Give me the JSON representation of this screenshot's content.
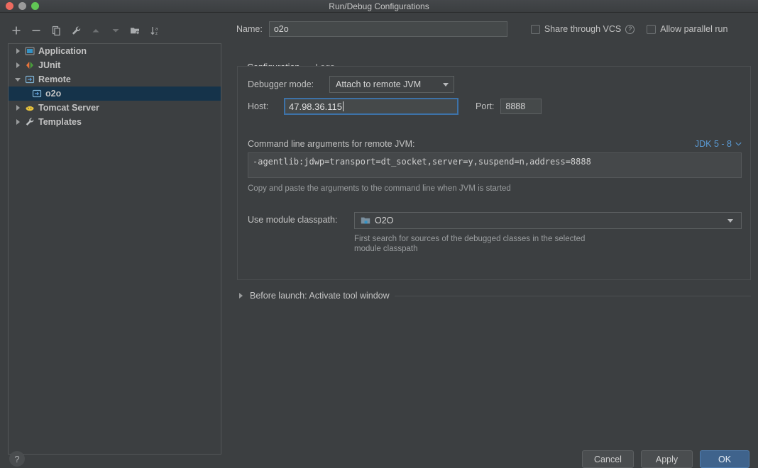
{
  "window": {
    "title": "Run/Debug Configurations",
    "controls": [
      "close",
      "minimize",
      "maximize"
    ]
  },
  "tree_toolbar": {
    "buttons": [
      {
        "name": "add-button",
        "icon": "plus-icon"
      },
      {
        "name": "remove-button",
        "icon": "minus-icon"
      },
      {
        "name": "copy-button",
        "icon": "copy-icon"
      },
      {
        "name": "edit-templates-button",
        "icon": "wrench-icon"
      },
      {
        "name": "move-up-button",
        "icon": "arrow-up-icon"
      },
      {
        "name": "move-down-button",
        "icon": "arrow-down-icon"
      },
      {
        "name": "new-folder-button",
        "icon": "folder-add-icon"
      },
      {
        "name": "sort-button",
        "icon": "sort-alpha-icon"
      }
    ]
  },
  "tree": {
    "items": [
      {
        "label": "Application",
        "icon": "application-icon",
        "expanded": false,
        "selected": false,
        "child": false
      },
      {
        "label": "JUnit",
        "icon": "junit-icon",
        "expanded": false,
        "selected": false,
        "child": false
      },
      {
        "label": "Remote",
        "icon": "remote-icon",
        "expanded": true,
        "selected": false,
        "child": false
      },
      {
        "label": "o2o",
        "icon": "remote-icon",
        "expanded": null,
        "selected": true,
        "child": true
      },
      {
        "label": "Tomcat Server",
        "icon": "tomcat-icon",
        "expanded": false,
        "selected": false,
        "child": false
      },
      {
        "label": "Templates",
        "icon": "wrench-icon",
        "expanded": false,
        "selected": false,
        "child": false
      }
    ]
  },
  "header": {
    "name_label": "Name:",
    "name_value": "o2o",
    "name_placeholder": "",
    "share_vcs_label": "Share through VCS",
    "share_vcs_checked": false,
    "share_vcs_help": "?",
    "allow_parallel_label": "Allow parallel run",
    "allow_parallel_checked": false
  },
  "tabs": [
    {
      "label": "Configuration",
      "active": true
    },
    {
      "label": "Logs",
      "active": false
    }
  ],
  "configuration": {
    "debugger_mode_label": "Debugger mode:",
    "debugger_mode_value": "Attach to remote JVM",
    "host_label": "Host:",
    "host_value": "47.98.36.115",
    "port_label": "Port:",
    "port_value": "8888",
    "args_label": "Command line arguments for remote JVM:",
    "jdk_link": "JDK 5 - 8",
    "args_value": "-agentlib:jdwp=transport=dt_socket,server=y,suspend=n,address=8888",
    "args_hint": "Copy and paste the arguments to the command line when JVM is started",
    "module_label": "Use module classpath:",
    "module_value": "O2O",
    "module_hint_line1": "First search for sources of the debugged classes in the selected",
    "module_hint_line2": "module classpath"
  },
  "before_launch": {
    "label": "Before launch: Activate tool window",
    "expanded": false
  },
  "footer": {
    "help_label": "?",
    "cancel_label": "Cancel",
    "apply_label": "Apply",
    "ok_label": "OK"
  },
  "colors": {
    "background": "#3c3f41",
    "selection": "#15334a",
    "accent": "#4a88c7",
    "link": "#5b9bd5",
    "focus_border": "#3d72a8",
    "primary_button": "#3f638c"
  }
}
